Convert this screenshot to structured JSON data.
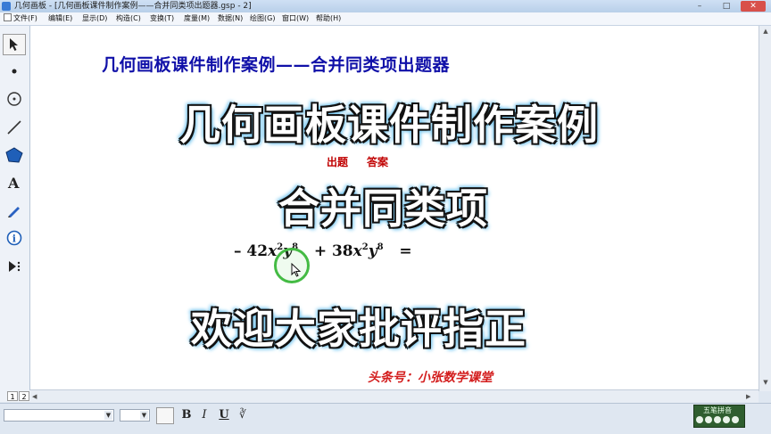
{
  "window": {
    "title": "几何画板 - [几何画板课件制作案例——合并同类项出题器.gsp - 2]",
    "controls": [
      "–",
      "□",
      "✕"
    ]
  },
  "menubar": {
    "items": [
      "文件(F)",
      "编辑(E)",
      "显示(D)",
      "构造(C)",
      "变换(T)",
      "度量(M)",
      "数据(N)",
      "绘图(G)",
      "窗口(W)",
      "帮助(H)"
    ]
  },
  "toolbox": {
    "tools": [
      "arrow-select-icon",
      "point-icon",
      "compass-icon",
      "straightedge-icon",
      "polygon-icon",
      "text-icon",
      "marker-icon",
      "info-icon",
      "custom-tool-icon"
    ]
  },
  "canvas": {
    "header": "几何画板课件制作案例——合并同类项出题器",
    "banner_top": "几何画板课件制作案例",
    "button_question": "出题",
    "button_answer": "答案",
    "banner_middle": "合并同类项",
    "expression": {
      "term1_coef": "– 42",
      "term2_coef": "+ 38",
      "var_x": "x",
      "var_y": "y",
      "exp_x": "2",
      "exp_y": "8",
      "equals": "="
    },
    "banner_bottom": "欢迎大家批评指正",
    "signature": "头条号：小张数学课堂"
  },
  "page_tabs": [
    "1",
    "2"
  ],
  "format_bar": {
    "bold": "B",
    "italic": "I",
    "underline": "U"
  },
  "ime": {
    "label": "五笔拼音"
  },
  "colors": {
    "header_text": "#1010a8",
    "button_text": "#c00000",
    "signature_text": "#d31d1d",
    "banner_glow": "#6fc3ee"
  }
}
